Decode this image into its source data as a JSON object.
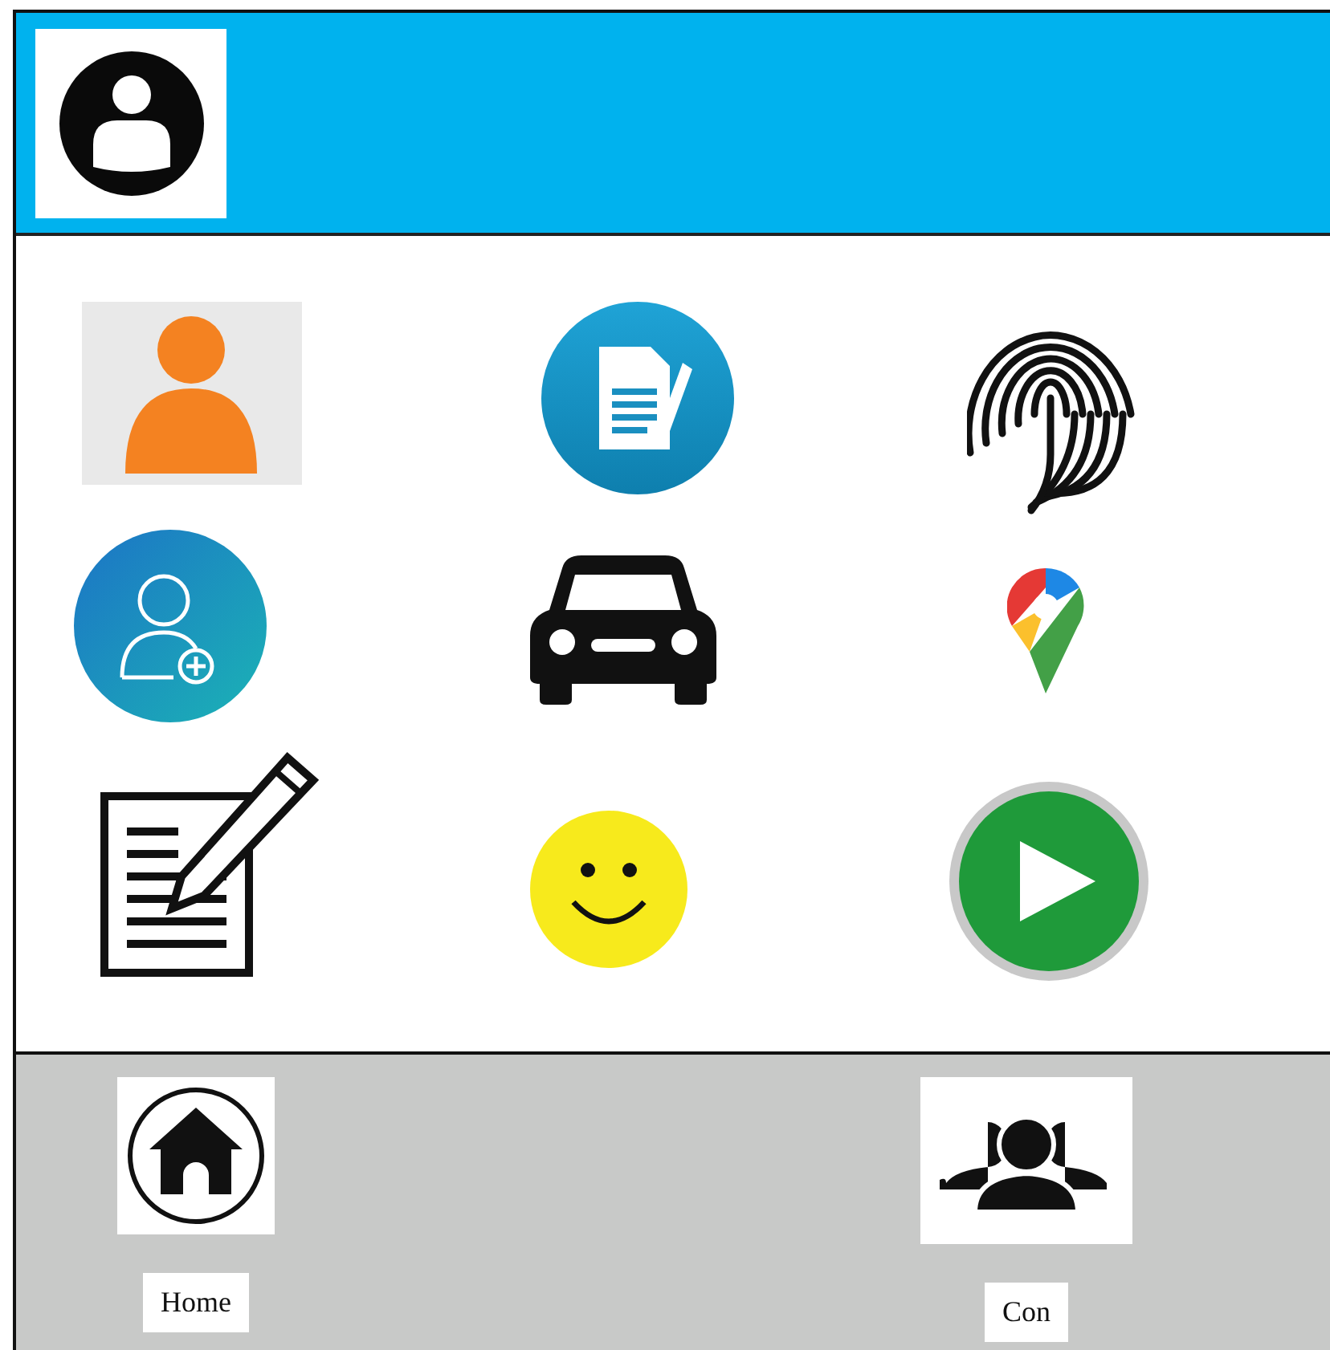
{
  "tiles": [
    {
      "kind": "person"
    },
    {
      "kind": "document"
    },
    {
      "kind": "fingerprint"
    },
    {
      "kind": "add-user"
    },
    {
      "kind": "car"
    },
    {
      "kind": "pin"
    },
    {
      "kind": "notes"
    },
    {
      "kind": "smiley"
    },
    {
      "kind": "play"
    }
  ],
  "nav": [
    {
      "kind": "home",
      "label": "Home"
    },
    {
      "kind": "group",
      "label": "Con"
    }
  ]
}
